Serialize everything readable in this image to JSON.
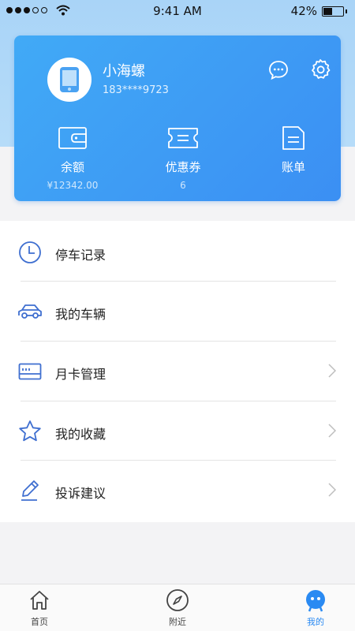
{
  "status_bar": {
    "time": "9:41 AM",
    "battery": "42%"
  },
  "user": {
    "name": "小海螺",
    "phone": "183****9723"
  },
  "stats": [
    {
      "label": "余额",
      "value": "¥12342.00"
    },
    {
      "label": "优惠券",
      "value": "6"
    },
    {
      "label": "账单",
      "value": ""
    }
  ],
  "menu": [
    {
      "label": "停车记录"
    },
    {
      "label": "我的车辆"
    },
    {
      "label": "月卡管理"
    },
    {
      "label": "我的收藏"
    },
    {
      "label": "投诉建议"
    }
  ],
  "tabs": [
    {
      "label": "首页"
    },
    {
      "label": "附近"
    },
    {
      "label": "我的"
    }
  ],
  "colors": {
    "accent": "#2a8af2",
    "card_start": "#41aaf6",
    "card_end": "#3b8ff3",
    "icon_blue": "#3f6fd0"
  }
}
